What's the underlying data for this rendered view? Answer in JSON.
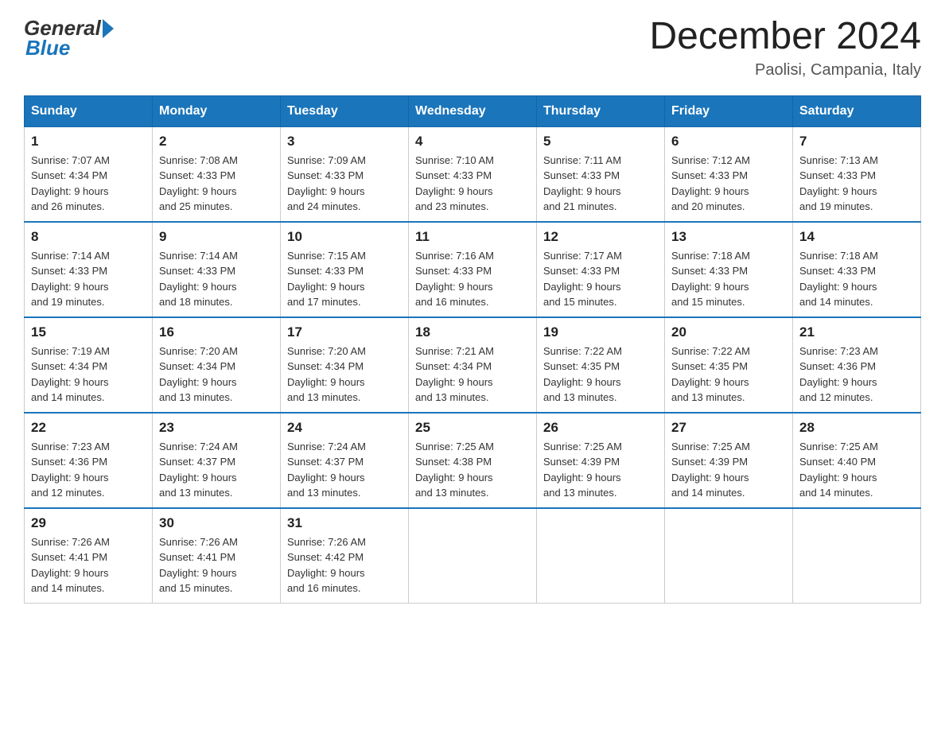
{
  "header": {
    "logo": {
      "general": "General",
      "blue": "Blue"
    },
    "title": "December 2024",
    "location": "Paolisi, Campania, Italy"
  },
  "calendar": {
    "days_of_week": [
      "Sunday",
      "Monday",
      "Tuesday",
      "Wednesday",
      "Thursday",
      "Friday",
      "Saturday"
    ],
    "weeks": [
      [
        {
          "day": "1",
          "sunrise": "7:07 AM",
          "sunset": "4:34 PM",
          "daylight": "9 hours and 26 minutes."
        },
        {
          "day": "2",
          "sunrise": "7:08 AM",
          "sunset": "4:33 PM",
          "daylight": "9 hours and 25 minutes."
        },
        {
          "day": "3",
          "sunrise": "7:09 AM",
          "sunset": "4:33 PM",
          "daylight": "9 hours and 24 minutes."
        },
        {
          "day": "4",
          "sunrise": "7:10 AM",
          "sunset": "4:33 PM",
          "daylight": "9 hours and 23 minutes."
        },
        {
          "day": "5",
          "sunrise": "7:11 AM",
          "sunset": "4:33 PM",
          "daylight": "9 hours and 21 minutes."
        },
        {
          "day": "6",
          "sunrise": "7:12 AM",
          "sunset": "4:33 PM",
          "daylight": "9 hours and 20 minutes."
        },
        {
          "day": "7",
          "sunrise": "7:13 AM",
          "sunset": "4:33 PM",
          "daylight": "9 hours and 19 minutes."
        }
      ],
      [
        {
          "day": "8",
          "sunrise": "7:14 AM",
          "sunset": "4:33 PM",
          "daylight": "9 hours and 19 minutes."
        },
        {
          "day": "9",
          "sunrise": "7:14 AM",
          "sunset": "4:33 PM",
          "daylight": "9 hours and 18 minutes."
        },
        {
          "day": "10",
          "sunrise": "7:15 AM",
          "sunset": "4:33 PM",
          "daylight": "9 hours and 17 minutes."
        },
        {
          "day": "11",
          "sunrise": "7:16 AM",
          "sunset": "4:33 PM",
          "daylight": "9 hours and 16 minutes."
        },
        {
          "day": "12",
          "sunrise": "7:17 AM",
          "sunset": "4:33 PM",
          "daylight": "9 hours and 15 minutes."
        },
        {
          "day": "13",
          "sunrise": "7:18 AM",
          "sunset": "4:33 PM",
          "daylight": "9 hours and 15 minutes."
        },
        {
          "day": "14",
          "sunrise": "7:18 AM",
          "sunset": "4:33 PM",
          "daylight": "9 hours and 14 minutes."
        }
      ],
      [
        {
          "day": "15",
          "sunrise": "7:19 AM",
          "sunset": "4:34 PM",
          "daylight": "9 hours and 14 minutes."
        },
        {
          "day": "16",
          "sunrise": "7:20 AM",
          "sunset": "4:34 PM",
          "daylight": "9 hours and 13 minutes."
        },
        {
          "day": "17",
          "sunrise": "7:20 AM",
          "sunset": "4:34 PM",
          "daylight": "9 hours and 13 minutes."
        },
        {
          "day": "18",
          "sunrise": "7:21 AM",
          "sunset": "4:34 PM",
          "daylight": "9 hours and 13 minutes."
        },
        {
          "day": "19",
          "sunrise": "7:22 AM",
          "sunset": "4:35 PM",
          "daylight": "9 hours and 13 minutes."
        },
        {
          "day": "20",
          "sunrise": "7:22 AM",
          "sunset": "4:35 PM",
          "daylight": "9 hours and 13 minutes."
        },
        {
          "day": "21",
          "sunrise": "7:23 AM",
          "sunset": "4:36 PM",
          "daylight": "9 hours and 12 minutes."
        }
      ],
      [
        {
          "day": "22",
          "sunrise": "7:23 AM",
          "sunset": "4:36 PM",
          "daylight": "9 hours and 12 minutes."
        },
        {
          "day": "23",
          "sunrise": "7:24 AM",
          "sunset": "4:37 PM",
          "daylight": "9 hours and 13 minutes."
        },
        {
          "day": "24",
          "sunrise": "7:24 AM",
          "sunset": "4:37 PM",
          "daylight": "9 hours and 13 minutes."
        },
        {
          "day": "25",
          "sunrise": "7:25 AM",
          "sunset": "4:38 PM",
          "daylight": "9 hours and 13 minutes."
        },
        {
          "day": "26",
          "sunrise": "7:25 AM",
          "sunset": "4:39 PM",
          "daylight": "9 hours and 13 minutes."
        },
        {
          "day": "27",
          "sunrise": "7:25 AM",
          "sunset": "4:39 PM",
          "daylight": "9 hours and 14 minutes."
        },
        {
          "day": "28",
          "sunrise": "7:25 AM",
          "sunset": "4:40 PM",
          "daylight": "9 hours and 14 minutes."
        }
      ],
      [
        {
          "day": "29",
          "sunrise": "7:26 AM",
          "sunset": "4:41 PM",
          "daylight": "9 hours and 14 minutes."
        },
        {
          "day": "30",
          "sunrise": "7:26 AM",
          "sunset": "4:41 PM",
          "daylight": "9 hours and 15 minutes."
        },
        {
          "day": "31",
          "sunrise": "7:26 AM",
          "sunset": "4:42 PM",
          "daylight": "9 hours and 16 minutes."
        },
        null,
        null,
        null,
        null
      ]
    ],
    "labels": {
      "sunrise": "Sunrise:",
      "sunset": "Sunset:",
      "daylight": "Daylight:"
    }
  }
}
